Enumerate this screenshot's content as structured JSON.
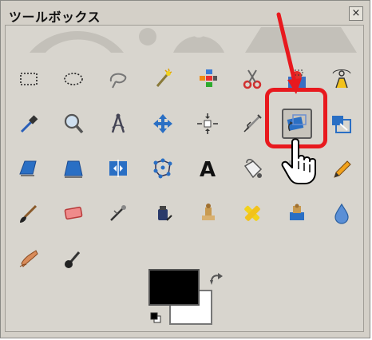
{
  "window": {
    "title": "ツールボックス",
    "close_label": "×"
  },
  "tools": [
    {
      "name": "rect-select-tool-icon",
      "interactable": true
    },
    {
      "name": "ellipse-select-tool-icon",
      "interactable": true
    },
    {
      "name": "free-select-tool-icon",
      "interactable": true
    },
    {
      "name": "fuzzy-select-tool-icon",
      "interactable": true
    },
    {
      "name": "select-by-color-tool-icon",
      "interactable": true
    },
    {
      "name": "scissors-select-tool-icon",
      "interactable": true
    },
    {
      "name": "foreground-select-tool-icon",
      "interactable": true
    },
    {
      "name": "paths-tool-icon",
      "interactable": true
    },
    {
      "name": "color-picker-tool-icon",
      "interactable": true
    },
    {
      "name": "zoom-tool-icon",
      "interactable": true
    },
    {
      "name": "measure-tool-icon",
      "interactable": true
    },
    {
      "name": "move-tool-icon",
      "interactable": true
    },
    {
      "name": "align-tool-icon",
      "interactable": true
    },
    {
      "name": "crop-tool-icon",
      "interactable": true
    },
    {
      "name": "rotate-tool-icon",
      "interactable": true,
      "active": true
    },
    {
      "name": "scale-tool-icon",
      "interactable": true
    },
    {
      "name": "shear-tool-icon",
      "interactable": true
    },
    {
      "name": "perspective-tool-icon",
      "interactable": true
    },
    {
      "name": "flip-tool-icon",
      "interactable": true
    },
    {
      "name": "cage-transform-tool-icon",
      "interactable": true
    },
    {
      "name": "text-tool-icon",
      "interactable": true
    },
    {
      "name": "bucket-fill-tool-icon",
      "interactable": true
    },
    {
      "name": "blend-tool-icon",
      "interactable": true
    },
    {
      "name": "pencil-tool-icon",
      "interactable": true
    },
    {
      "name": "paintbrush-tool-icon",
      "interactable": true
    },
    {
      "name": "eraser-tool-icon",
      "interactable": true
    },
    {
      "name": "airbrush-tool-icon",
      "interactable": true
    },
    {
      "name": "ink-tool-icon",
      "interactable": true
    },
    {
      "name": "clone-tool-icon",
      "interactable": true
    },
    {
      "name": "heal-tool-icon",
      "interactable": true
    },
    {
      "name": "perspective-clone-tool-icon",
      "interactable": true
    },
    {
      "name": "blur-sharpen-tool-icon",
      "interactable": true
    },
    {
      "name": "smudge-tool-icon",
      "interactable": true
    },
    {
      "name": "dodge-burn-tool-icon",
      "interactable": true
    }
  ],
  "colors": {
    "foreground": "#000000",
    "background": "#ffffff",
    "highlight": "#e8191e"
  }
}
